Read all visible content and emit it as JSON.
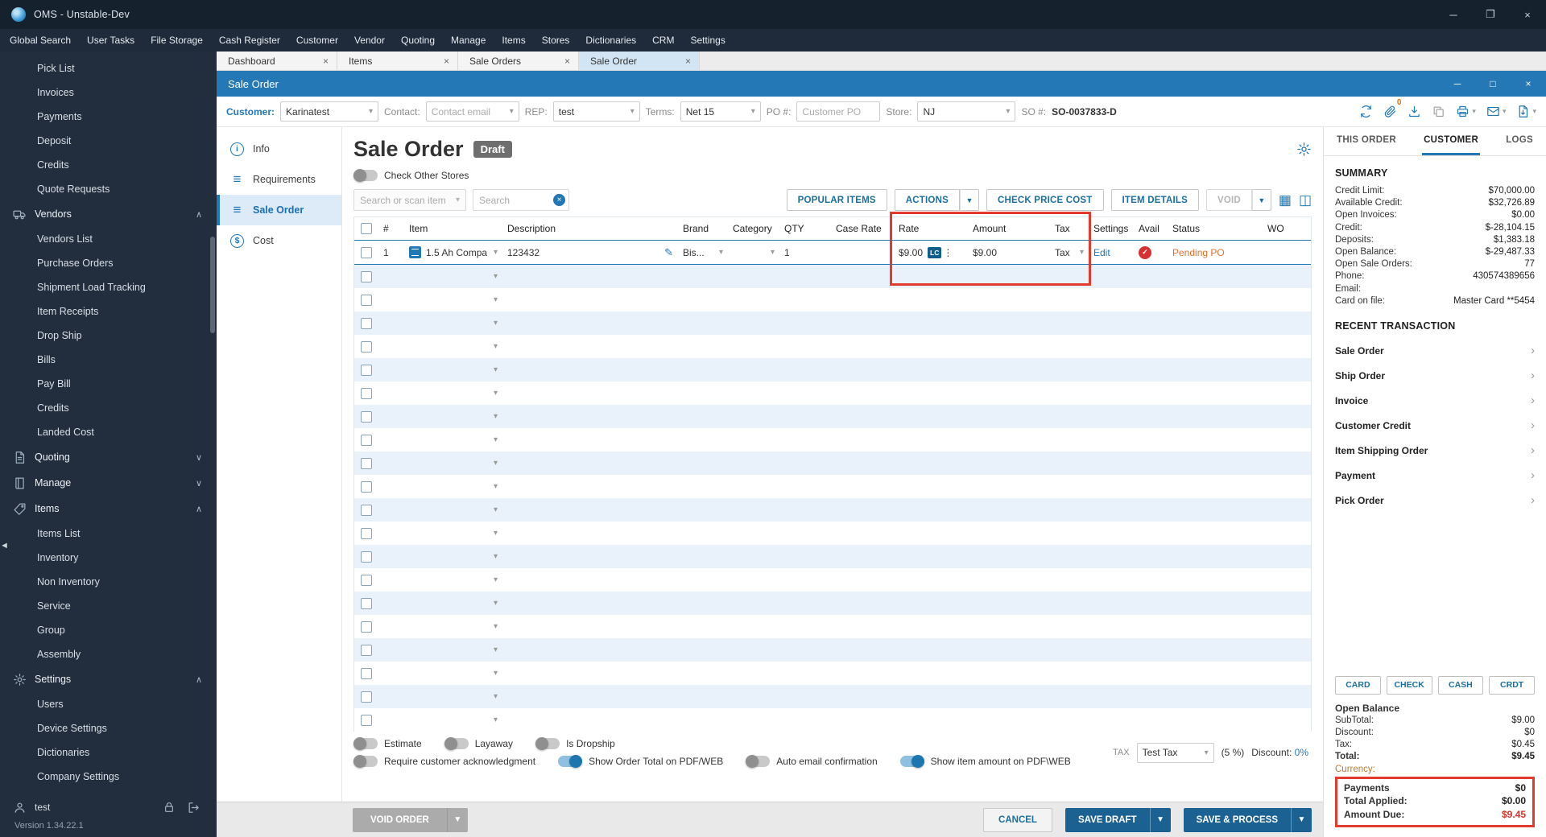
{
  "colors": {
    "accent": "#2178b5",
    "annotation_red": "#e23b2e",
    "status_orange": "#e0712c",
    "amount_red": "#d3322b",
    "primary_button": "#1b6191"
  },
  "titlebar": {
    "title": "OMS - Unstable-Dev"
  },
  "menubar": {
    "items": [
      "Global Search",
      "User Tasks",
      "File Storage",
      "Cash Register",
      "Customer",
      "Vendor",
      "Quoting",
      "Manage",
      "Items",
      "Stores",
      "Dictionaries",
      "CRM",
      "Settings"
    ]
  },
  "sidebar": {
    "items": [
      {
        "label": "Pick List",
        "type": "sub"
      },
      {
        "label": "Invoices",
        "type": "sub"
      },
      {
        "label": "Payments",
        "type": "sub"
      },
      {
        "label": "Deposit",
        "type": "sub"
      },
      {
        "label": "Credits",
        "type": "sub"
      },
      {
        "label": "Quote Requests",
        "type": "sub"
      },
      {
        "label": "Vendors",
        "type": "section",
        "icon": "vendors-icon",
        "chevron": "∧"
      },
      {
        "label": "Vendors List",
        "type": "sub"
      },
      {
        "label": "Purchase Orders",
        "type": "sub"
      },
      {
        "label": "Shipment Load Tracking",
        "type": "sub"
      },
      {
        "label": "Item Receipts",
        "type": "sub"
      },
      {
        "label": "Drop Ship",
        "type": "sub"
      },
      {
        "label": "Bills",
        "type": "sub"
      },
      {
        "label": "Pay Bill",
        "type": "sub"
      },
      {
        "label": "Credits",
        "type": "sub"
      },
      {
        "label": "Landed Cost",
        "type": "sub"
      },
      {
        "label": "Quoting",
        "type": "section",
        "icon": "quoting-icon",
        "chevron": "∨"
      },
      {
        "label": "Manage",
        "type": "section",
        "icon": "manage-icon",
        "chevron": "∨"
      },
      {
        "label": "Items",
        "type": "section",
        "icon": "items-icon",
        "chevron": "∧"
      },
      {
        "label": "Items List",
        "type": "sub"
      },
      {
        "label": "Inventory",
        "type": "sub"
      },
      {
        "label": "Non Inventory",
        "type": "sub"
      },
      {
        "label": "Service",
        "type": "sub"
      },
      {
        "label": "Group",
        "type": "sub"
      },
      {
        "label": "Assembly",
        "type": "sub"
      },
      {
        "label": "Settings",
        "type": "section",
        "icon": "settings-icon",
        "chevron": "∧"
      },
      {
        "label": "Users",
        "type": "sub"
      },
      {
        "label": "Device Settings",
        "type": "sub"
      },
      {
        "label": "Dictionaries",
        "type": "sub"
      },
      {
        "label": "Company Settings",
        "type": "sub"
      }
    ],
    "user_name": "test",
    "version": "Version 1.34.22.1"
  },
  "tabbar": {
    "tabs": [
      {
        "label": "Dashboard"
      },
      {
        "label": "Items"
      },
      {
        "label": "Sale Orders"
      },
      {
        "label": "Sale Order",
        "active": true
      }
    ]
  },
  "order_window": {
    "title": "Sale Order",
    "form": {
      "customer_label": "Customer:",
      "customer_value": "Karinatest",
      "contact_label": "Contact:",
      "contact_placeholder": "Contact email",
      "rep_label": "REP:",
      "rep_value": "test",
      "terms_label": "Terms:",
      "terms_value": "Net 15",
      "po_label": "PO #:",
      "po_placeholder": "Customer PO",
      "store_label": "Store:",
      "store_value": "NJ",
      "so_label": "SO #:",
      "so_value": "SO-0037833-D",
      "attachment_count": "0"
    },
    "nav": {
      "items": [
        {
          "label": "Info"
        },
        {
          "label": "Requirements"
        },
        {
          "label": "Sale Order",
          "active": true
        },
        {
          "label": "Cost"
        }
      ]
    },
    "page": {
      "title": "Sale Order",
      "badge": "Draft",
      "check_other_stores": "Check Other Stores",
      "item_search_placeholder": "Search or scan item",
      "search_placeholder": "Search",
      "toolbar": {
        "popular_items": "POPULAR ITEMS",
        "actions": "ACTIONS",
        "check_price_cost": "CHECK PRICE COST",
        "item_details": "ITEM DETAILS",
        "void": "VOID"
      }
    },
    "table": {
      "columns": [
        "#",
        "Item",
        "Description",
        "Brand",
        "Category",
        "QTY",
        "Case Rate",
        "Rate",
        "Amount",
        "Tax",
        "Settings",
        "Avail",
        "Status",
        "WO"
      ],
      "row": {
        "num": "1",
        "item_name": "1.5 Ah Compa",
        "description": "123432",
        "brand": "Bis...",
        "qty": "1",
        "rate": "$9.00",
        "rate_badge": "LC",
        "amount": "$9.00",
        "tax": "Tax",
        "settings_label": "Edit",
        "status": "Pending PO"
      },
      "empty_row_count": 20
    },
    "footer": {
      "toggles_row1": [
        {
          "label": "Estimate"
        },
        {
          "label": "Layaway"
        },
        {
          "label": "Is Dropship"
        }
      ],
      "toggles_row2": [
        {
          "label": "Require customer acknowledgment"
        },
        {
          "label": "Show Order Total on PDF/WEB",
          "on": true
        },
        {
          "label": "Auto email confirmation"
        },
        {
          "label": "Show item amount on PDF\\WEB",
          "on": true
        }
      ],
      "tax_label": "TAX",
      "tax_value": "Test Tax",
      "tax_rate": "(5 %)",
      "discount_label": "Discount:",
      "discount_value": "0%"
    },
    "bottom_bar": {
      "void_order": "VOID ORDER",
      "cancel": "CANCEL",
      "save_draft": "SAVE DRAFT",
      "save_and_process": "SAVE & PROCESS"
    }
  },
  "right_panel": {
    "tabs": [
      {
        "label": "THIS ORDER"
      },
      {
        "label": "CUSTOMER",
        "active": true
      },
      {
        "label": "LOGS"
      }
    ],
    "summary": {
      "title": "SUMMARY",
      "rows": [
        {
          "label": "Credit Limit:",
          "value": "$70,000.00"
        },
        {
          "label": "Available Credit:",
          "value": "$32,726.89"
        },
        {
          "label": "Open Invoices:",
          "value": "$0.00"
        },
        {
          "label": "Credit:",
          "value": "$-28,104.15"
        },
        {
          "label": "Deposits:",
          "value": "$1,383.18"
        },
        {
          "label": "Open Balance:",
          "value": "$-29,487.33"
        },
        {
          "label": "Open Sale Orders:",
          "value": "77"
        },
        {
          "label": "Phone:",
          "value": "430574389656"
        },
        {
          "label": "Email:",
          "value": ""
        },
        {
          "label": "Card on file:",
          "value": "Master Card **5454"
        }
      ]
    },
    "recent": {
      "title": "RECENT TRANSACTION",
      "items": [
        "Sale Order",
        "Ship Order",
        "Invoice",
        "Customer Credit",
        "Item Shipping Order",
        "Payment",
        "Pick Order"
      ]
    },
    "payment_buttons": [
      "CARD",
      "CHECK",
      "CASH",
      "CRDT"
    ],
    "totals": {
      "header": "Open Balance",
      "rows": [
        {
          "label": "SubTotal:",
          "value": "$9.00"
        },
        {
          "label": "Discount:",
          "value": "$0"
        },
        {
          "label": "Tax:",
          "value": "$0.45"
        },
        {
          "label": "Total:",
          "value": "$9.45",
          "bold": true
        }
      ],
      "currency_label": "Currency:"
    },
    "payments_box": {
      "rows": [
        {
          "label": "Payments",
          "value": "$0",
          "bold": true
        },
        {
          "label": "Total Applied:",
          "value": "$0.00",
          "bold": true
        },
        {
          "label": "Amount Due:",
          "value": "$9.45",
          "bold": true,
          "red": true
        }
      ]
    }
  }
}
